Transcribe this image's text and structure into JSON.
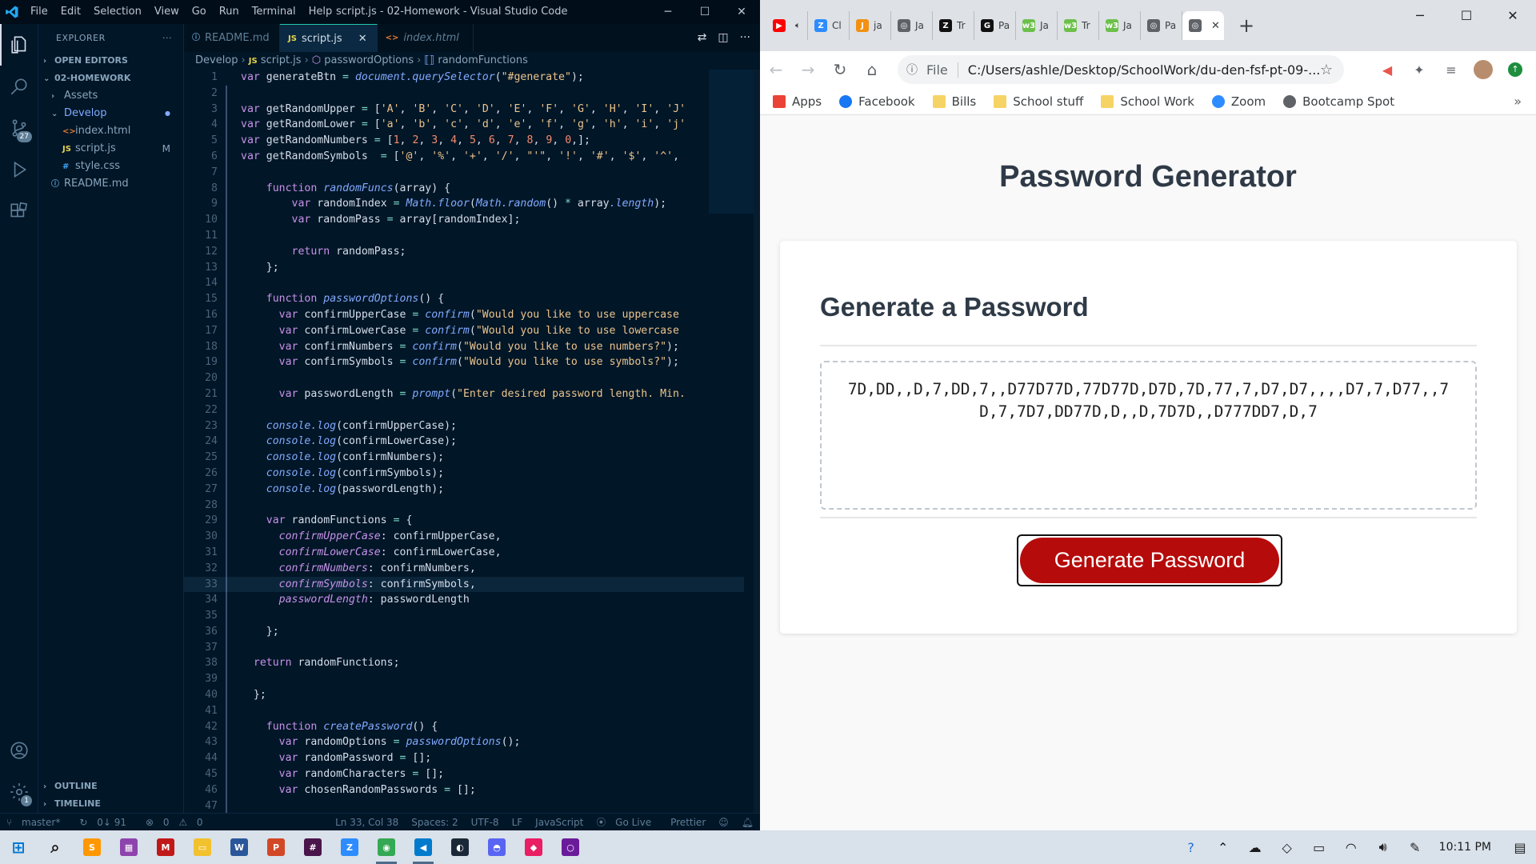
{
  "vscode": {
    "title": "script.js - 02-Homework - Visual Studio Code",
    "menu": [
      "File",
      "Edit",
      "Selection",
      "View",
      "Go",
      "Run",
      "Terminal",
      "Help"
    ],
    "activity_badge": "27",
    "settings_badge": "1",
    "explorer": {
      "header": "EXPLORER",
      "open_editors": "OPEN EDITORS",
      "folder": "02-HOMEWORK",
      "items": [
        {
          "label": "Assets",
          "type": "folder"
        },
        {
          "label": "Develop",
          "type": "folder-open"
        },
        {
          "label": "index.html",
          "type": "html"
        },
        {
          "label": "script.js",
          "type": "js",
          "mark": "M"
        },
        {
          "label": "style.css",
          "type": "css"
        },
        {
          "label": "README.md",
          "type": "info"
        }
      ],
      "outline": "OUTLINE",
      "timeline": "TIMELINE"
    },
    "tabs": [
      {
        "label": "README.md",
        "icon": "ⓘ"
      },
      {
        "label": "script.js",
        "icon": "JS"
      },
      {
        "label": "index.html",
        "icon": "<>"
      }
    ],
    "breadcrumb": [
      "Develop",
      "script.js",
      "passwordOptions",
      "randomFunctions"
    ],
    "code_lines": [
      "var generateBtn = document.querySelector(\"#generate\");",
      "",
      "var getRandomUpper = ['A', 'B', 'C', 'D', 'E', 'F', 'G', 'H', 'I', 'J'",
      "var getRandomLower = ['a', 'b', 'c', 'd', 'e', 'f', 'g', 'h', 'i', 'j'",
      "var getRandomNumbers = [1, 2, 3, 4, 5, 6, 7, 8, 9, 0,];",
      "var getRandomSymbols  = ['@', '%', '+', '/', \"'\", '!', '#', '$', '^',",
      "",
      "    function randomFuncs(array) {",
      "        var randomIndex = Math.floor(Math.random() * array.length);",
      "        var randomPass = array[randomIndex];",
      "",
      "        return randomPass;",
      "    };",
      "",
      "    function passwordOptions() {",
      "      var confirmUpperCase = confirm(\"Would you like to use uppercase",
      "      var confirmLowerCase = confirm(\"Would you like to use lowercase",
      "      var confirmNumbers = confirm(\"Would you like to use numbers?\");",
      "      var confirmSymbols = confirm(\"Would you like to use symbols?\");",
      "",
      "      var passwordLength = prompt(\"Enter desired password length. Min.",
      "",
      "    console.log(confirmUpperCase);",
      "    console.log(confirmLowerCase);",
      "    console.log(confirmNumbers);",
      "    console.log(confirmSymbols);",
      "    console.log(passwordLength);",
      "",
      "    var randomFunctions = {",
      "      confirmUpperCase: confirmUpperCase,",
      "      confirmLowerCase: confirmLowerCase,",
      "      confirmNumbers: confirmNumbers,",
      "      confirmSymbols: confirmSymbols,",
      "      passwordLength: passwordLength",
      "",
      "    };",
      "",
      "  return randomFunctions;",
      "",
      "  };",
      "",
      "    function createPassword() {",
      "      var randomOptions = passwordOptions();",
      "      var randomPassword = [];",
      "      var randomCharacters = [];",
      "      var chosenRandomPasswords = [];",
      ""
    ],
    "current_line": 33,
    "status": {
      "branch": "master*",
      "sync": "0↓ 91",
      "problems": "0",
      "warnings": "0",
      "position": "Ln 33, Col 38",
      "spaces": "Spaces: 2",
      "encoding": "UTF-8",
      "eol": "LF",
      "language": "JavaScript",
      "golive": "Go Live",
      "prettier": "Prettier"
    }
  },
  "chrome": {
    "tabs": [
      {
        "label": "",
        "color": "#ff0000",
        "glyph": "▶"
      },
      {
        "label": "Cl",
        "color": "#2d8cff",
        "glyph": "Z"
      },
      {
        "label": "ja",
        "color": "#f29111",
        "glyph": "J"
      },
      {
        "label": "Ja",
        "color": "#5f6368",
        "glyph": "◎"
      },
      {
        "label": "Tr",
        "color": "#111111",
        "glyph": "Z"
      },
      {
        "label": "Pa",
        "color": "#111111",
        "glyph": "G"
      },
      {
        "label": "Ja",
        "color": "#6cc04a",
        "glyph": "w3"
      },
      {
        "label": "Tr",
        "color": "#6cc04a",
        "glyph": "w3"
      },
      {
        "label": "Ja",
        "color": "#6cc04a",
        "glyph": "w3"
      },
      {
        "label": "Pa",
        "color": "#5f6368",
        "glyph": "◎"
      },
      {
        "label": "",
        "color": "#5f6368",
        "glyph": "◎"
      }
    ],
    "url_scheme": "File",
    "url": "C:/Users/ashle/Desktop/SchoolWork/du-den-fsf-pt-09-...",
    "bookmarks": [
      {
        "label": "Apps",
        "color": "#ea4335"
      },
      {
        "label": "Facebook",
        "color": "#1877f2"
      },
      {
        "label": "Bills",
        "color": "#f6d365"
      },
      {
        "label": "School stuff",
        "color": "#f6d365"
      },
      {
        "label": "School Work",
        "color": "#f6d365"
      },
      {
        "label": "Zoom",
        "color": "#2d8cff"
      },
      {
        "label": "Bootcamp Spot",
        "color": "#5f6368"
      }
    ],
    "page": {
      "title": "Password Generator",
      "card_header": "Generate a Password",
      "password": "7D,DD,,D,7,DD,7,,D77D77D,77D77D,D7D,7D,77,7,D7,D7,,,,D7,7,D77,,7D,7,7D7,DD77D,D,,D,7D7D,,D777DD7,D,7",
      "button": "Generate Password"
    }
  },
  "taskbar": {
    "apps": [
      {
        "name": "windows-start",
        "color": "#0078d4",
        "glyph": "⊞"
      },
      {
        "name": "search",
        "color": "#1b1b1b",
        "glyph": "⌕"
      },
      {
        "name": "sublime",
        "color": "#ff9800",
        "glyph": "S"
      },
      {
        "name": "app-1",
        "color": "#8e44ad",
        "glyph": "▦"
      },
      {
        "name": "mcafee",
        "color": "#c01818",
        "glyph": "M"
      },
      {
        "name": "file-explorer",
        "color": "#f2c12e",
        "glyph": "▭"
      },
      {
        "name": "word",
        "color": "#2b579a",
        "glyph": "W"
      },
      {
        "name": "powerpoint",
        "color": "#d24726",
        "glyph": "P"
      },
      {
        "name": "slack",
        "color": "#4a154b",
        "glyph": "#"
      },
      {
        "name": "zoom",
        "color": "#2d8cff",
        "glyph": "Z"
      },
      {
        "name": "chrome",
        "color": "#34a853",
        "glyph": "◉"
      },
      {
        "name": "vscode",
        "color": "#007acc",
        "glyph": "◀"
      },
      {
        "name": "steam",
        "color": "#1b2838",
        "glyph": "◐"
      },
      {
        "name": "discord",
        "color": "#5865f2",
        "glyph": "◓"
      },
      {
        "name": "app-2",
        "color": "#e91e63",
        "glyph": "◆"
      },
      {
        "name": "app-3",
        "color": "#6a1b9a",
        "glyph": "○"
      }
    ],
    "time": "10:11 PM"
  }
}
